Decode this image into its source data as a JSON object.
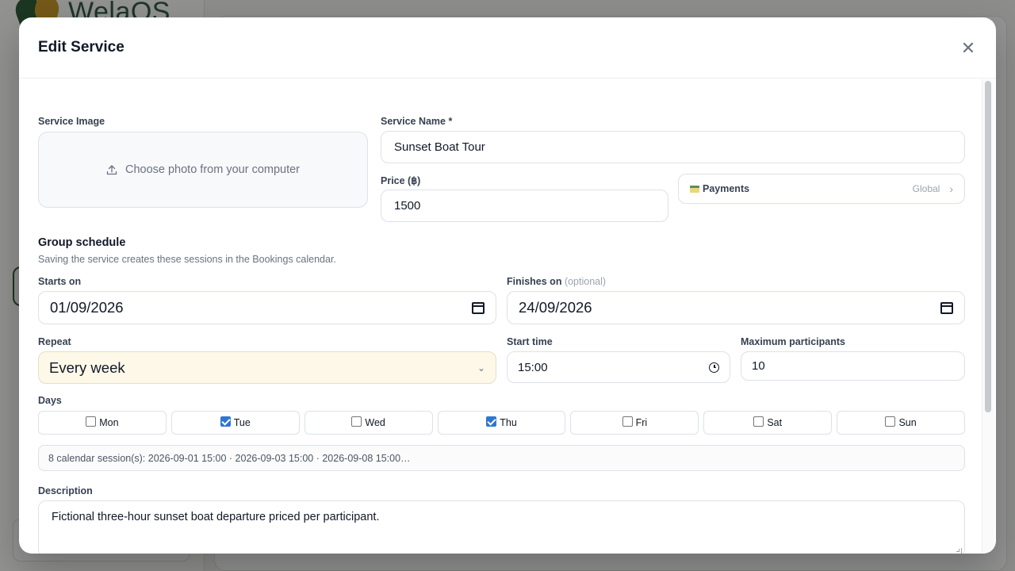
{
  "background": {
    "logo_text": "WelaOS"
  },
  "modal": {
    "title": "Edit Service",
    "close_icon": "close-icon",
    "service_image": {
      "label": "Service Image",
      "upload_text": "Choose photo from your computer",
      "icon": "upload-icon"
    },
    "service_name": {
      "label": "Service Name *",
      "value": "Sunset Boat Tour"
    },
    "price": {
      "label": "Price (฿)",
      "value": "1500"
    },
    "payments": {
      "label": "Payments",
      "value": "Global",
      "icon": "card-icon"
    },
    "group_schedule": {
      "title": "Group schedule",
      "subtitle": "Saving the service creates these sessions in the Bookings calendar."
    },
    "starts_on": {
      "label": "Starts on",
      "value": "01/09/2026"
    },
    "finishes_on": {
      "label": "Finishes on",
      "optional": "(optional)",
      "value": "24/09/2026"
    },
    "repeat": {
      "label": "Repeat",
      "value": "Every week"
    },
    "start_time": {
      "label": "Start time",
      "value": "15:00"
    },
    "max_participants": {
      "label": "Maximum participants",
      "value": "10"
    },
    "days": {
      "label": "Days",
      "items": [
        {
          "label": "Mon",
          "checked": false
        },
        {
          "label": "Tue",
          "checked": true
        },
        {
          "label": "Wed",
          "checked": false
        },
        {
          "label": "Thu",
          "checked": true
        },
        {
          "label": "Fri",
          "checked": false
        },
        {
          "label": "Sat",
          "checked": false
        },
        {
          "label": "Sun",
          "checked": false
        }
      ]
    },
    "sessions_summary": "8 calendar session(s): 2026-09-01 15:00 · 2026-09-03 15:00 · 2026-09-08 15:00…",
    "description": {
      "label": "Description",
      "value": "Fictional three-hour sunset boat departure priced per participant."
    }
  },
  "colors": {
    "checkbox_checked": "#2f76d2",
    "select_bg": "#fdf8e8",
    "brand_green": "#2f5d3a"
  }
}
